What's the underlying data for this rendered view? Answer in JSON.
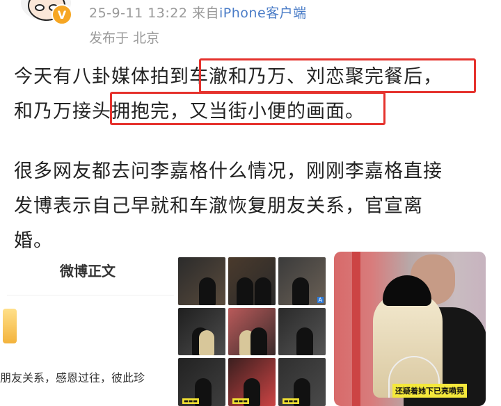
{
  "header": {
    "timestamp": "25-9-11 13:22",
    "source_prefix": "来自",
    "source_device": "iPhone",
    "source_suffix": "客户端",
    "location": "发布于 北京",
    "verified_badge": "V"
  },
  "post": {
    "lines": [
      "今天有八卦媒体拍到车澈和乃万、刘恋聚完餐后，",
      "和乃万接头拥抱完，又当街小便的画面。",
      "很多网友都去问李嘉格什么情况，刚刚李嘉格直接",
      "发博表示自己早就和车澈恢复朋友关系，官宣离",
      "婚。"
    ]
  },
  "weibo_screenshot": {
    "title": "微博正文",
    "snippet": "朋友关系，感恩过往，彼此珍"
  },
  "photo": {
    "caption": "还疑着她下已亮嗬晃"
  },
  "colors": {
    "highlight": "#e5322d",
    "link": "#4a7cc7",
    "meta": "#999999"
  }
}
